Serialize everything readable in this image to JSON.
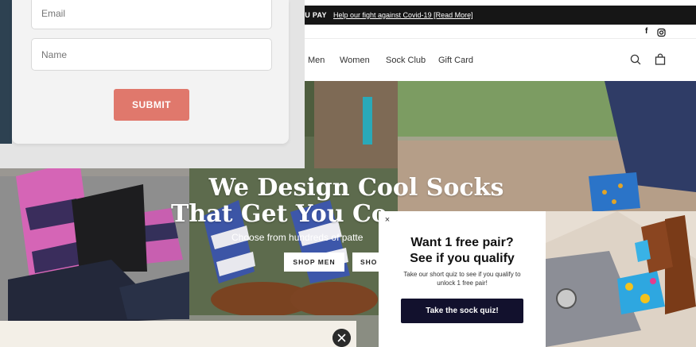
{
  "announcement": {
    "prefix": "OU PAY",
    "link": "Help our fight against Covid-19 [Read More]"
  },
  "social": {
    "facebook": "f",
    "instagram": "instagram-icon"
  },
  "nav": {
    "items": [
      "Men",
      "Women",
      "Sock Club",
      "Gift Card"
    ],
    "search_icon": "search-icon",
    "cart_icon": "shopping-bag-icon"
  },
  "hero": {
    "title_line1": "We Design Cool Socks",
    "title_line2": "That Get You Co",
    "subtitle": "Choose from hundreds of patte",
    "button_men": "SHOP MEN",
    "button_women": "SHO"
  },
  "capture_form": {
    "email_placeholder": "Email",
    "name_placeholder": "Name",
    "submit_label": "SUBMIT"
  },
  "quiz_popup": {
    "close_label": "×",
    "heading_line1": "Want 1 free pair?",
    "heading_line2": "See if you qualify",
    "body": "Take our short quiz to see if you qualify to unlock 1 free pair!",
    "button_label": "Take the sock quiz!"
  },
  "bottom_bar": {
    "close_icon": "close-icon"
  },
  "colors": {
    "submit": "#e0786c",
    "quiz_button": "#12112d",
    "announcement_bg": "#161616",
    "bottom_bar_bg": "#f3efe7"
  }
}
